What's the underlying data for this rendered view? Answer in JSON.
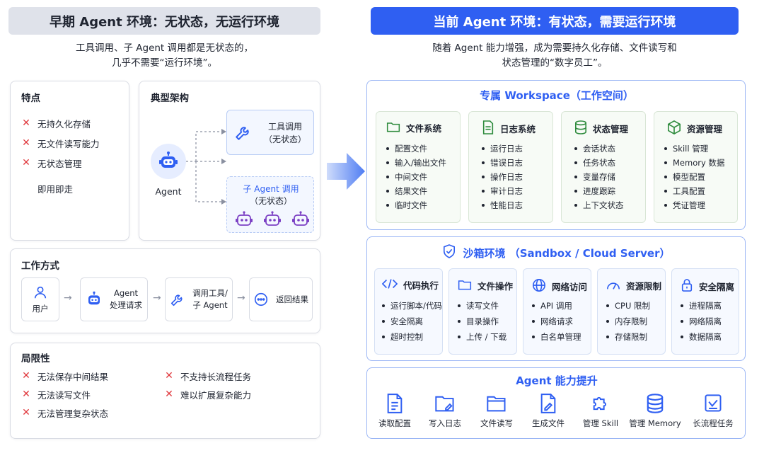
{
  "left": {
    "title": "早期 Agent 环境：无状态，无运行环境",
    "subtitle_line1": "工具调用、子 Agent 调用都是无状态的，",
    "subtitle_line2": "几乎不需要“运行环境”。",
    "features": {
      "title": "特点",
      "items": [
        "无持久化存储",
        "无文件读写能力",
        "无状态管理"
      ],
      "extra": "即用即走"
    },
    "arch": {
      "title": "典型架构",
      "agent_label": "Agent",
      "tool_label": "工具调用",
      "tool_sub": "（无状态）",
      "sub_agent_label": "子 Agent 调用",
      "sub_agent_sub": "（无状态）"
    },
    "workflow": {
      "title": "工作方式",
      "steps": [
        {
          "line1": "用户",
          "line2": ""
        },
        {
          "line1": "Agent",
          "line2": "处理请求"
        },
        {
          "line1": "调用工具/",
          "line2": "子 Agent"
        },
        {
          "line1": "返回结果",
          "line2": ""
        }
      ]
    },
    "limits": {
      "title": "局限性",
      "col1": [
        "无法保存中间结果",
        "无法读写文件",
        "无法管理复杂状态"
      ],
      "col2": [
        "不支持长流程任务",
        "难以扩展复杂能力"
      ]
    }
  },
  "right": {
    "title": "当前 Agent 环境：有状态，需要运行环境",
    "subtitle_line1": "随着 Agent 能力增强，成为需要持久化存储、文件读写和",
    "subtitle_line2": "状态管理的“数字员工”。",
    "workspace": {
      "title": "专属 Workspace（工作空间）",
      "cards": [
        {
          "title": "文件系统",
          "icon": "folder-icon",
          "items": [
            "配置文件",
            "输入/输出文件",
            "中间文件",
            "结果文件",
            "临时文件"
          ]
        },
        {
          "title": "日志系统",
          "icon": "log-icon",
          "items": [
            "运行日志",
            "错误日志",
            "操作日志",
            "审计日志",
            "性能日志"
          ]
        },
        {
          "title": "状态管理",
          "icon": "database-icon",
          "items": [
            "会话状态",
            "任务状态",
            "变量存储",
            "进度跟踪",
            "上下文状态"
          ]
        },
        {
          "title": "资源管理",
          "icon": "cube-icon",
          "items": [
            "Skill 管理",
            "Memory 数据",
            "模型配置",
            "工具配置",
            "凭证管理"
          ]
        }
      ]
    },
    "sandbox": {
      "title": "沙箱环境 （Sandbox / Cloud Server）",
      "cards": [
        {
          "title": "代码执行",
          "icon": "code-icon",
          "items": [
            "运行脚本/代码",
            "安全隔离",
            "超时控制"
          ]
        },
        {
          "title": "文件操作",
          "icon": "folder-icon",
          "items": [
            "读写文件",
            "目录操作",
            "上传 / 下载"
          ]
        },
        {
          "title": "网络访问",
          "icon": "globe-icon",
          "items": [
            "API 调用",
            "网络请求",
            "白名单管理"
          ]
        },
        {
          "title": "资源限制",
          "icon": "gauge-icon",
          "items": [
            "CPU 限制",
            "内存限制",
            "存储限制"
          ]
        },
        {
          "title": "安全隔离",
          "icon": "lock-icon",
          "items": [
            "进程隔离",
            "网络隔离",
            "数据隔离"
          ]
        }
      ]
    },
    "capabilities": {
      "title": "Agent 能力提升",
      "items": [
        {
          "label": "读取配置",
          "icon": "document-icon"
        },
        {
          "label": "写入日志",
          "icon": "folder-edit-icon"
        },
        {
          "label": "文件读写",
          "icon": "folder-icon"
        },
        {
          "label": "生成文件",
          "icon": "file-edit-icon"
        },
        {
          "label": "管理 Skill",
          "icon": "puzzle-icon"
        },
        {
          "label": "管理 Memory",
          "icon": "database-icon"
        },
        {
          "label": "长流程任务",
          "icon": "chart-icon"
        }
      ]
    }
  },
  "colors": {
    "accent_blue": "#2f5ff2",
    "green_icon": "#2e8b3d",
    "red_x": "#e0393e",
    "purple_robot": "#7b3fc4"
  }
}
